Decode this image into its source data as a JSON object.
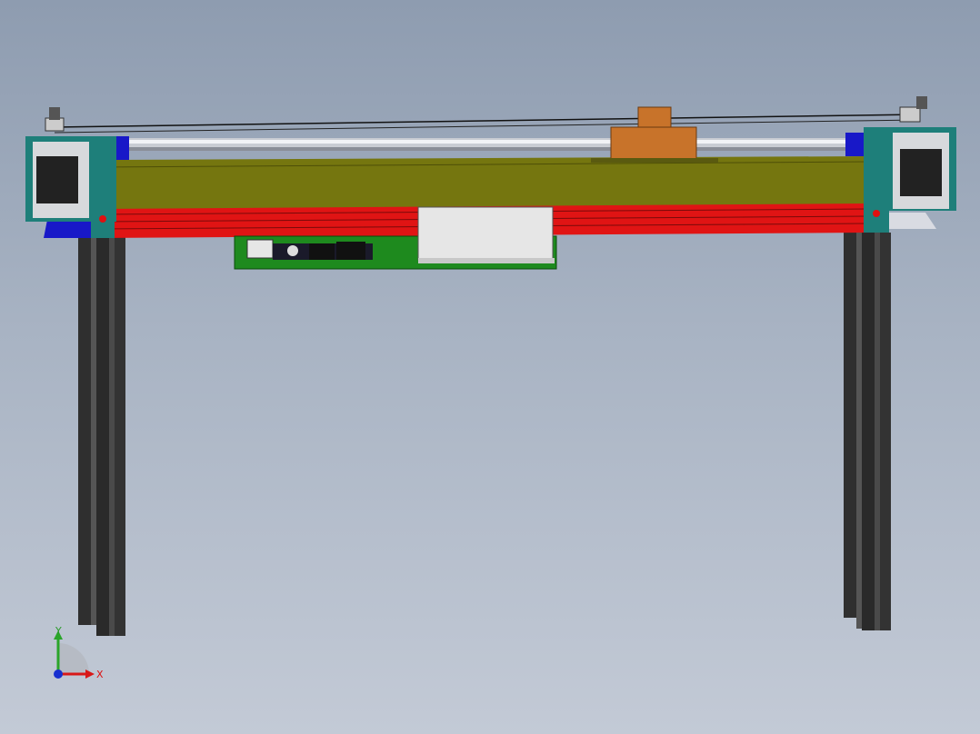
{
  "viewport": {
    "background_top": "#8e9cb0",
    "background_bottom": "#c3cad6"
  },
  "model": {
    "colors": {
      "top_plate": "#75760f",
      "lower_rail": "#e01010",
      "side_bracket": "#1e7f7a",
      "leg_profile": "#3a3a3a",
      "rod": "#c9ccd3",
      "carriage": "#c8732a",
      "pcb": "#1e8a1e",
      "power_supply": "#e6e6e6",
      "motor_body": "#d7d9dc",
      "end_block": "#1818c8"
    }
  },
  "triad": {
    "x_label": "X",
    "y_label": "Y",
    "x_color": "#d81818",
    "y_color": "#2aa52a",
    "z_color": "#1830d0"
  }
}
